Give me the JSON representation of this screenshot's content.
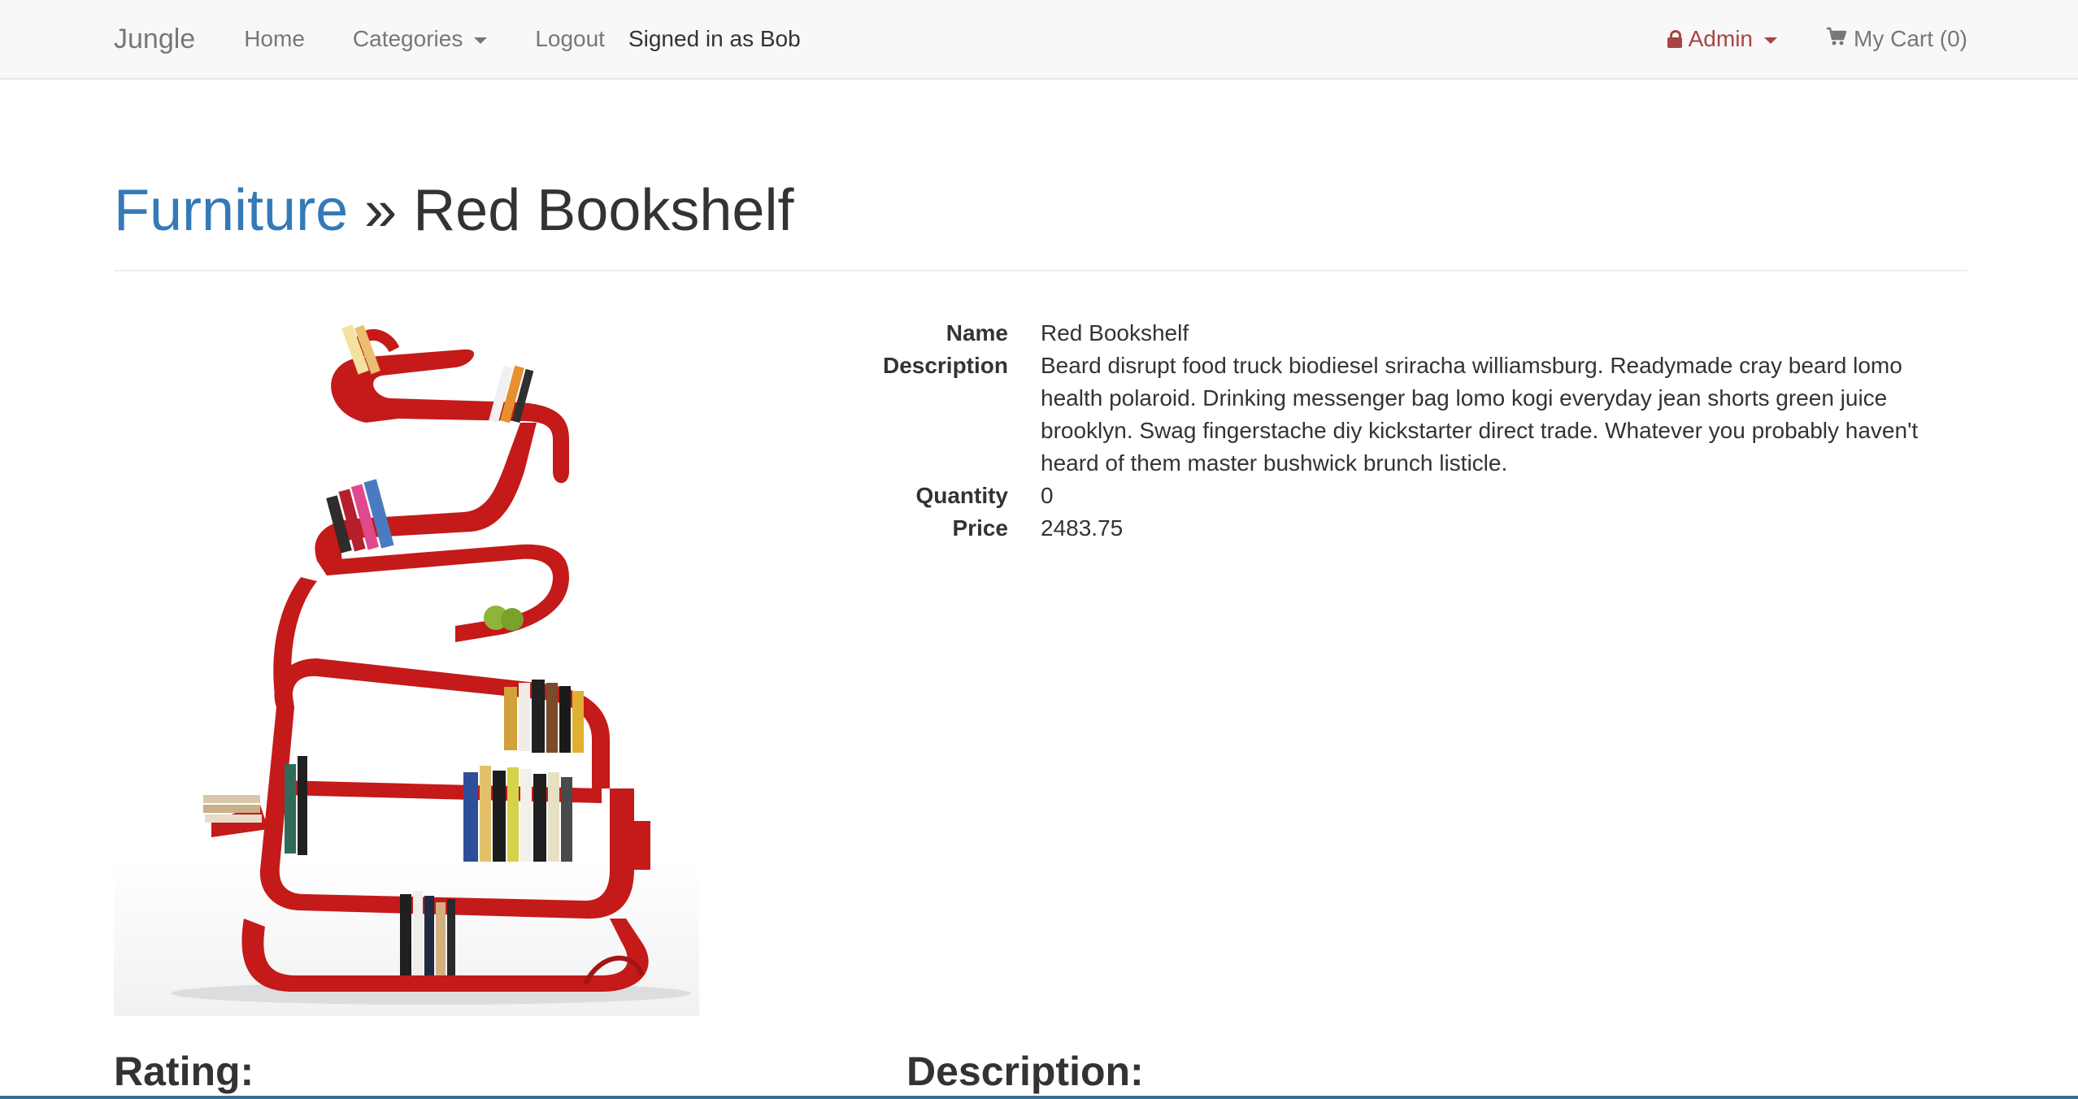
{
  "navbar": {
    "brand": "Jungle",
    "home_label": "Home",
    "categories_label": "Categories",
    "logout_label": "Logout",
    "signed_in_text": "Signed in as Bob",
    "admin_label": "Admin",
    "cart_label": "My Cart (0)"
  },
  "page_header": {
    "category": "Furniture",
    "separator": "»",
    "product_name": "Red Bookshelf"
  },
  "product": {
    "image_alt": "Red Bookshelf",
    "fields": [
      {
        "label": "Name",
        "value": "Red Bookshelf"
      },
      {
        "label": "Description",
        "value": "Beard disrupt food truck biodiesel sriracha williamsburg. Readymade cray beard lomo health polaroid. Drinking messenger bag lomo kogi everyday jean shorts green juice brooklyn. Swag fingerstache diy kickstarter direct trade. Whatever you probably haven't heard of them master bushwick brunch listicle."
      },
      {
        "label": "Quantity",
        "value": "0"
      },
      {
        "label": "Price",
        "value": "2483.75"
      }
    ]
  },
  "sections": {
    "rating_heading": "Rating:",
    "description_heading": "Description:"
  },
  "colors": {
    "link": "#337ab7",
    "admin": "#a94442",
    "navbar_bg": "#f8f8f8",
    "shelf_red": "#c41a1a"
  },
  "icons": {
    "admin": "lock-icon",
    "cart": "cart-icon",
    "dropdown": "caret-down-icon"
  }
}
